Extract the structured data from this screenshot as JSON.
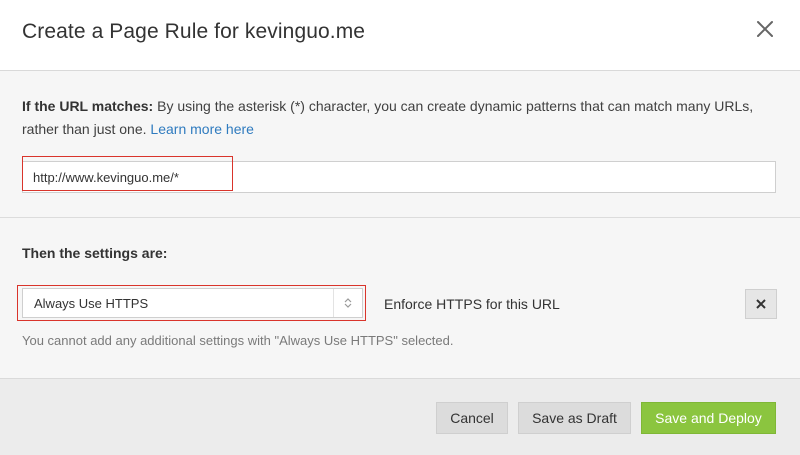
{
  "modal": {
    "title": "Create a Page Rule for kevinguo.me",
    "close_icon": "close-icon"
  },
  "url_section": {
    "label": "If the URL matches:",
    "description": " By using the asterisk (*) character, you can create dynamic patterns that can match many URLs, rather than just one. ",
    "learn_more": "Learn more here",
    "url_value": "http://www.kevinguo.me/*"
  },
  "settings_section": {
    "title": "Then the settings are:",
    "selected_setting": "Always Use HTTPS",
    "setting_description": "Enforce HTTPS for this URL",
    "note": "You cannot add any additional settings with \"Always Use HTTPS\" selected.",
    "remove_icon": "close-icon"
  },
  "footer": {
    "cancel": "Cancel",
    "save_draft": "Save as Draft",
    "save_deploy": "Save and Deploy"
  },
  "colors": {
    "accent_green": "#8bc53f",
    "link_blue": "#2f7bbf",
    "highlight_red": "#d9342b"
  }
}
